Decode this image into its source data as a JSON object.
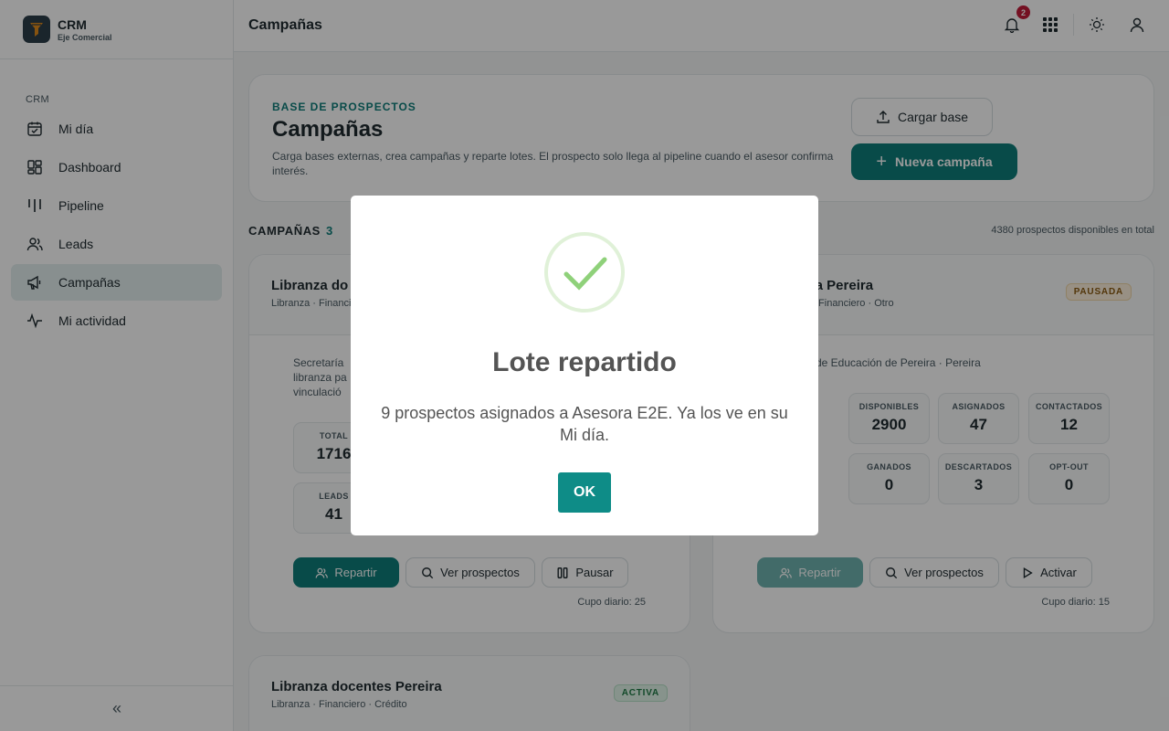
{
  "brand": {
    "title": "CRM",
    "subtitle": "Eje Comercial"
  },
  "sidebar": {
    "section": "CRM",
    "items": [
      {
        "label": "Mi día",
        "icon": "calendar-check-icon"
      },
      {
        "label": "Dashboard",
        "icon": "dashboard-grid-icon"
      },
      {
        "label": "Pipeline",
        "icon": "pipeline-columns-icon"
      },
      {
        "label": "Leads",
        "icon": "users-icon"
      },
      {
        "label": "Campañas",
        "icon": "megaphone-icon",
        "active": true
      },
      {
        "label": "Mi actividad",
        "icon": "activity-pulse-icon"
      }
    ],
    "collapse_label": "«"
  },
  "topbar": {
    "title": "Campañas",
    "notification_count": "2"
  },
  "hero": {
    "kicker": "BASE DE PROSPECTOS",
    "title": "Campañas",
    "description": "Carga bases externas, crea campañas y reparte lotes. El prospecto solo llega al pipeline cuando el asesor confirma interés.",
    "upload_label": "Cargar base",
    "new_label": "Nueva campaña"
  },
  "campaigns_section": {
    "label": "CAMPAÑAS",
    "count": "3",
    "total_available": "4380 prospectos disponibles en total"
  },
  "cards": [
    {
      "title": "Libranza do",
      "tags": "Libranza · Financiero",
      "entity": "Secretaría",
      "entity_line2": "libranza pa",
      "entity_line3": "vinculació",
      "stats": [
        {
          "label": "TOTAL",
          "value": "1716"
        },
        {
          "label": "LEADS",
          "value": "41"
        }
      ],
      "actions": {
        "distribute": "Repartir",
        "view": "Ver prospectos",
        "toggle": "Pausar"
      },
      "quota": "Cupo diario: 25"
    },
    {
      "title": "vida Pereira",
      "tags": "mo · Financiero · Otro",
      "status": "PAUSADA",
      "entity": "de Educación de Pereira · Pereira",
      "stats": [
        {
          "label": "DISPONIBLES",
          "value": "2900"
        },
        {
          "label": "ASIGNADOS",
          "value": "47"
        },
        {
          "label": "CONTACTADOS",
          "value": "12"
        },
        {
          "label": "GANADOS",
          "value": "0"
        },
        {
          "label": "DESCARTADOS",
          "value": "3"
        },
        {
          "label": "OPT-OUT",
          "value": "0"
        }
      ],
      "actions": {
        "distribute": "Repartir",
        "view": "Ver prospectos",
        "toggle": "Activar"
      },
      "quota": "Cupo diario: 15"
    },
    {
      "title": "Libranza docentes Pereira",
      "tags": "Libranza · Financiero · Crédito",
      "status": "ACTIVA"
    }
  ],
  "modal": {
    "title": "Lote repartido",
    "message": "9 prospectos asignados a Asesora E2E. Ya los ve en su Mi día.",
    "ok_label": "OK"
  },
  "colors": {
    "accent": "#0e7e7a",
    "success": "#8fd17a",
    "badge": "#c21c3a"
  }
}
